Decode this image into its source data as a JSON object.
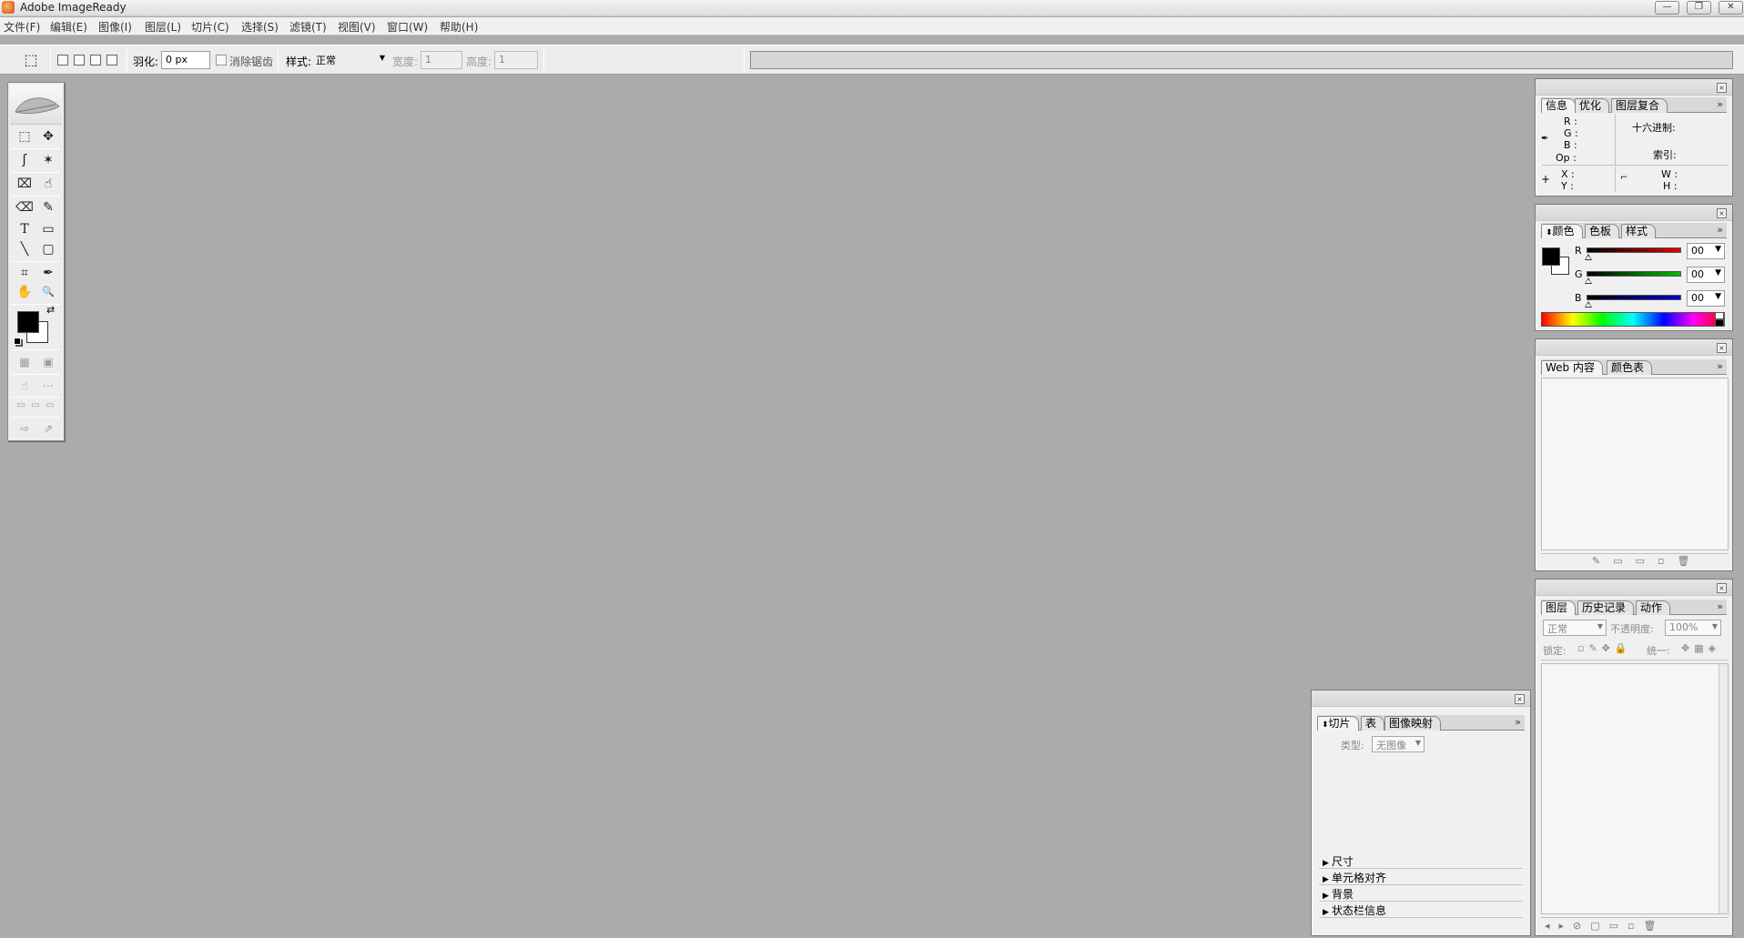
{
  "window": {
    "title": "Adobe ImageReady",
    "btn_min": "—",
    "btn_restore": "❐",
    "btn_close": "✕"
  },
  "menu": [
    "文件(F)",
    "编辑(E)",
    "图像(I)",
    "图层(L)",
    "切片(C)",
    "选择(S)",
    "滤镜(T)",
    "视图(V)",
    "窗口(W)",
    "帮助(H)"
  ],
  "options": {
    "feather_label": "羽化:",
    "feather_value": "0 px",
    "antialias_label": "消除锯齿",
    "style_label": "样式:",
    "style_value": "正常",
    "width_label": "宽度:",
    "width_value": "1",
    "height_label": "高度:",
    "height_value": "1"
  },
  "info_panel": {
    "tabs": [
      "信息",
      "优化",
      "图层复合"
    ],
    "r": "R :",
    "g": "G :",
    "b": "B :",
    "op": "Op :",
    "hex": "十六进制:",
    "index": "索引:",
    "x": "X :",
    "y": "Y :",
    "w": "W :",
    "h": "H :"
  },
  "color_panel": {
    "tabs": [
      "颜色",
      "色板",
      "样式"
    ],
    "r_label": "R",
    "g_label": "G",
    "b_label": "B",
    "r_value": "00",
    "g_value": "00",
    "b_value": "00",
    "colors": {
      "r": "#e00000",
      "g": "#00c000",
      "b": "#0000d8",
      "fg": "#000000",
      "bg": "#ffffff"
    }
  },
  "web_panel": {
    "tabs": [
      "Web 内容",
      "颜色表"
    ]
  },
  "layers_panel": {
    "tabs": [
      "图层",
      "历史记录",
      "动作"
    ],
    "blend_mode": "正常",
    "opacity_label": "不透明度:",
    "opacity_value": "100%",
    "lock_label": "锁定:",
    "unify_label": "统一:"
  },
  "slice_panel": {
    "tabs": [
      "切片",
      "表",
      "图像映射"
    ],
    "type_label": "类型:",
    "type_value": "无图像",
    "sections": [
      "尺寸",
      "单元格对齐",
      "背景",
      "状态栏信息"
    ]
  },
  "toolbox": {
    "tools": {
      "marquee": "⬚",
      "move": "✥",
      "lasso": "ʃ",
      "wand": "✶",
      "slice": "⌧",
      "slice_select": "☝",
      "eraser": "⌫",
      "brush": "✎",
      "type": "T",
      "rect": "▭",
      "line": "╲",
      "rounded_rect": "▢",
      "crop": "⌗",
      "eyedropper": "✒",
      "hand": "✋",
      "zoom": "🔍",
      "swap": "⇄"
    }
  }
}
